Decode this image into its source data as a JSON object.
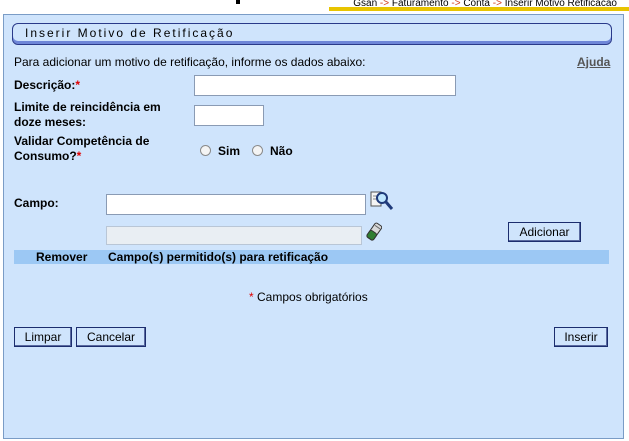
{
  "breadcrumb": [
    "Gsan",
    "Faturamento",
    "Conta",
    "Inserir Motivo Retificacao"
  ],
  "breadcrumb_sep": "->",
  "title": "Inserir Motivo de Retificação",
  "intro": "Para adicionar um motivo de retificação, informe os dados abaixo:",
  "help": "Ajuda",
  "fields": {
    "descricao": {
      "label": "Descrição:",
      "req": "*",
      "value": ""
    },
    "limite": {
      "label_1": "Limite de reincidência em",
      "label_2": "doze meses:",
      "value": ""
    },
    "validar": {
      "label_1": "Validar Competência de",
      "label_2": "Consumo?",
      "req": "*",
      "opt_sim": "Sim",
      "opt_nao": "Não"
    },
    "campo": {
      "label": "Campo:",
      "value": "",
      "value2": ""
    }
  },
  "buttons": {
    "adicionar": "Adicionar",
    "limpar": "Limpar",
    "cancelar": "Cancelar",
    "inserir": "Inserir"
  },
  "table": {
    "col_remover": "Remover",
    "col_campos": "Campo(s) permitido(s) para retificação"
  },
  "required_note": {
    "star": "*",
    "text": "Campos obrigatórios"
  },
  "colors": {
    "panel": "#cfe4fc",
    "header": "#9cc8f4",
    "required": "#e00000",
    "accent": "#e8c400"
  }
}
